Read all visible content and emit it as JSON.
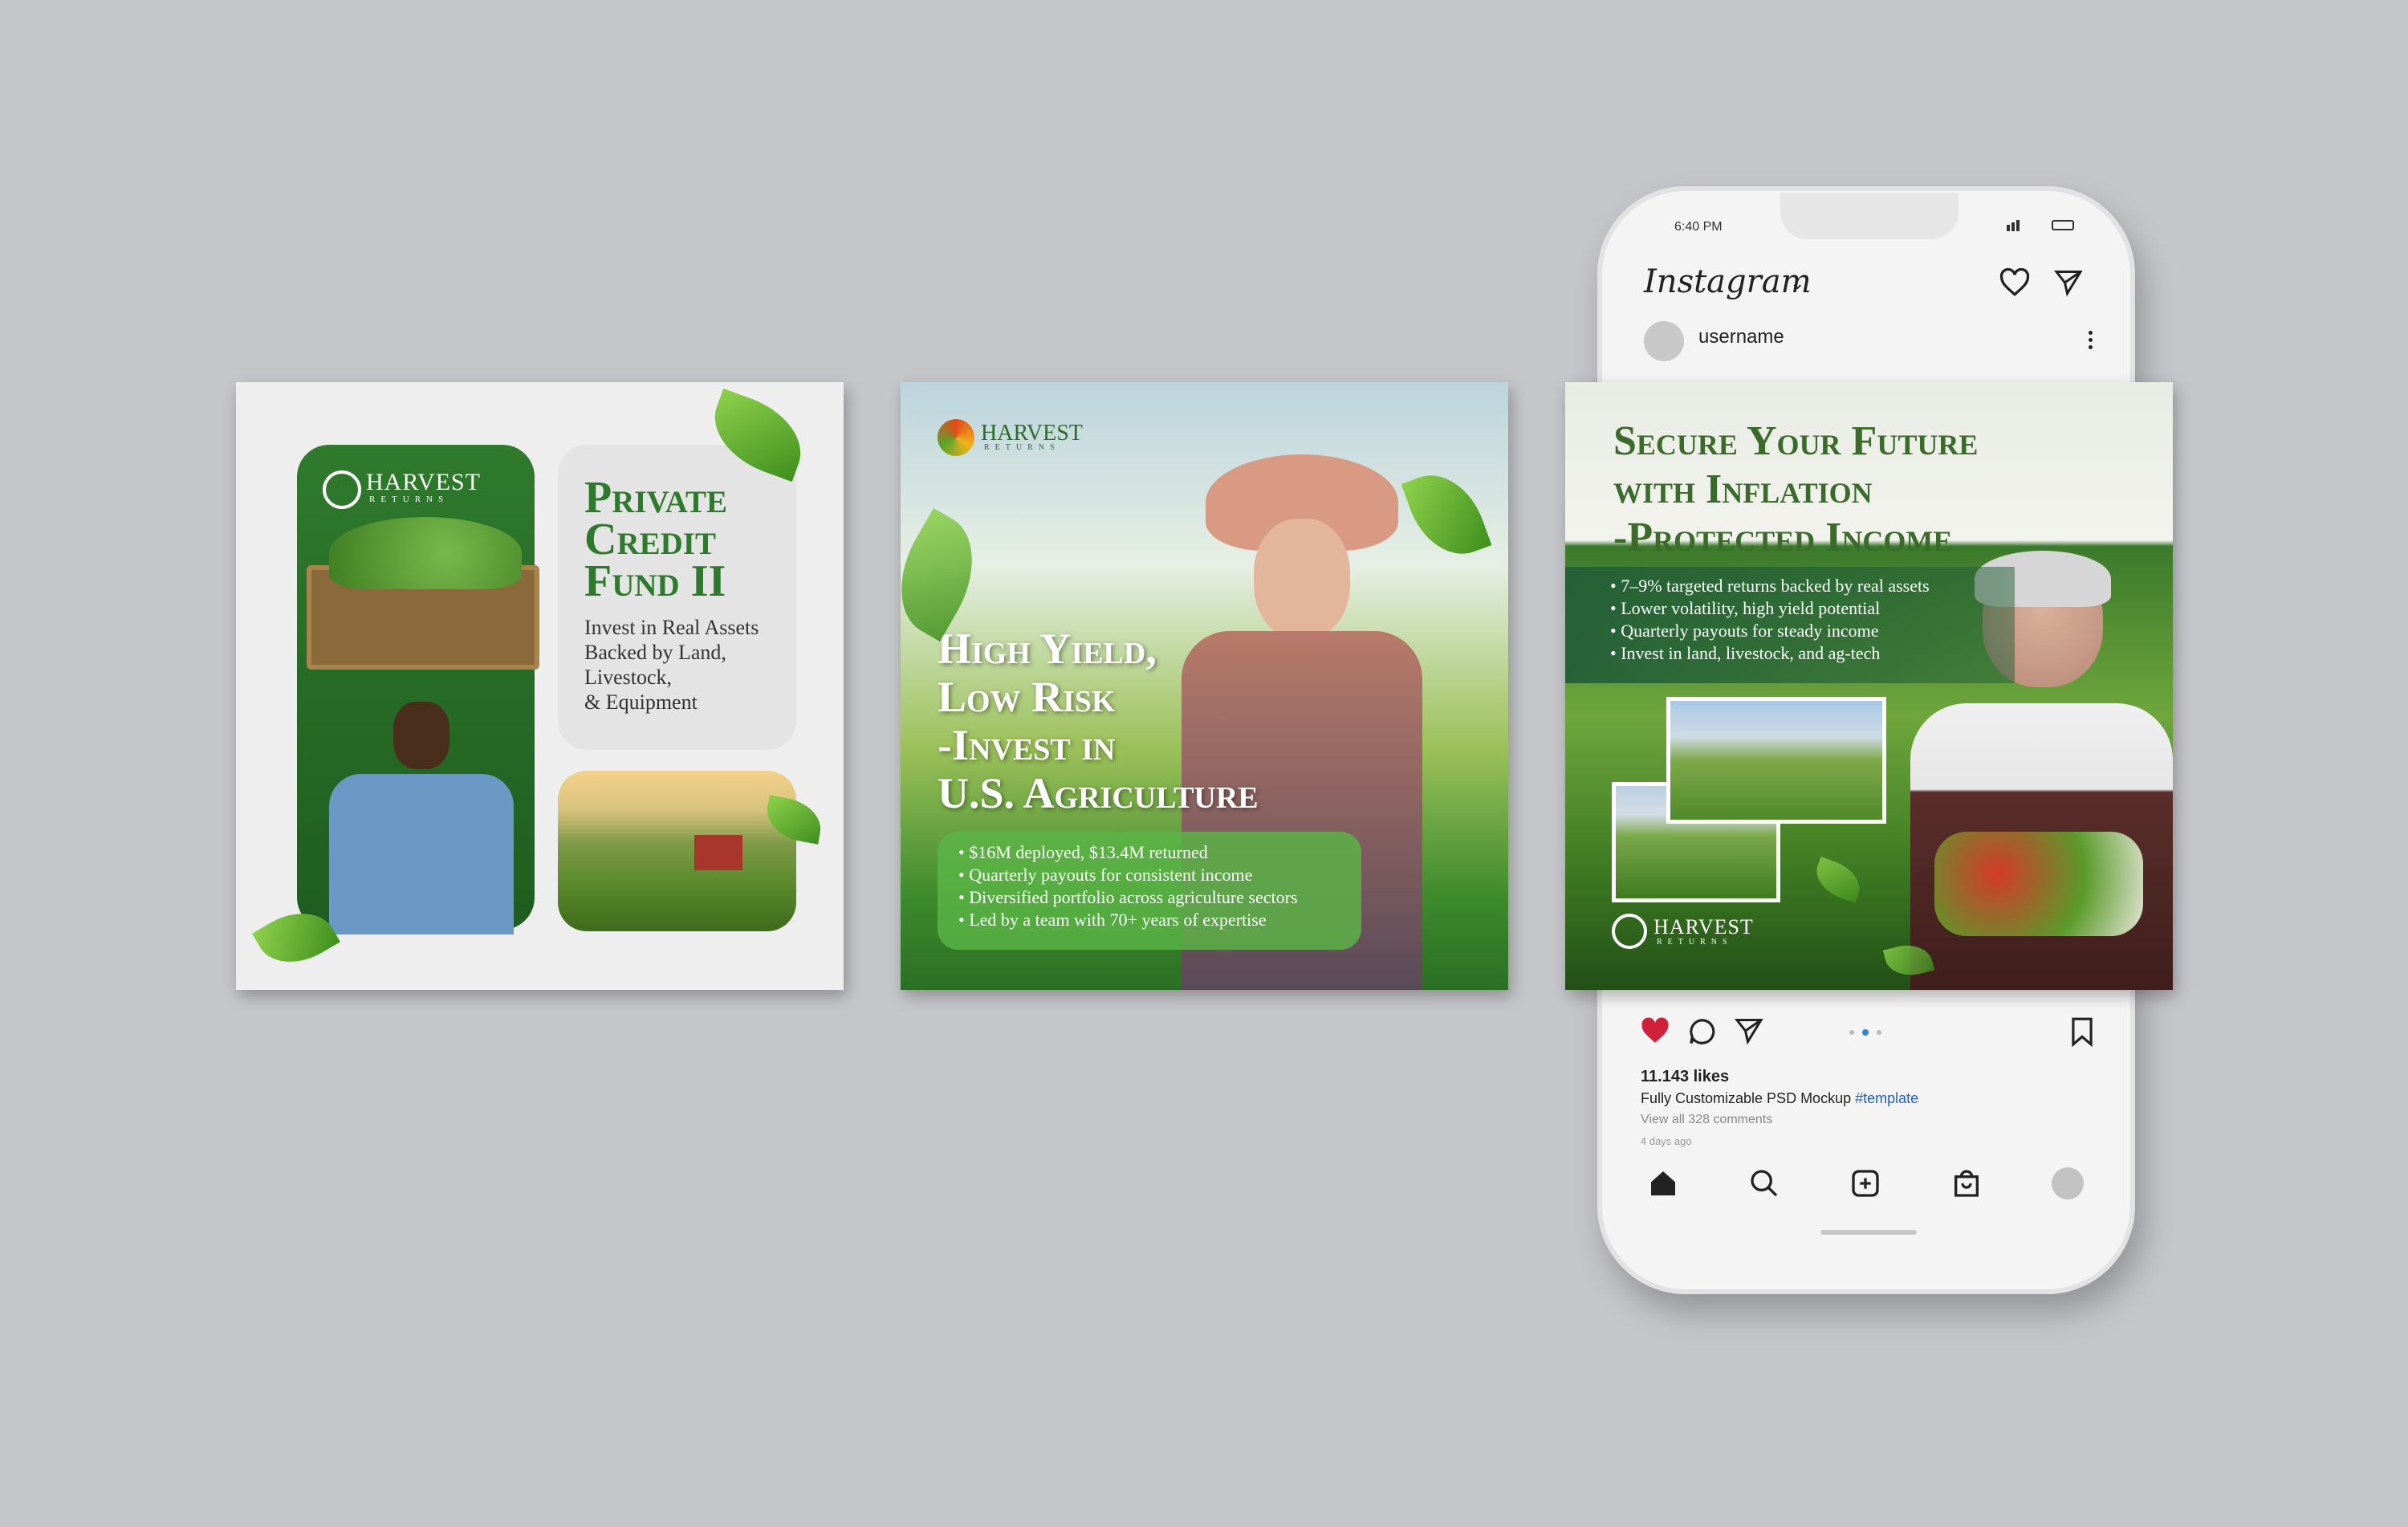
{
  "card1": {
    "logo": {
      "name": "HARVEST",
      "tagline": "RETURNS"
    },
    "title_lines": [
      "Private",
      "Credit",
      "Fund II"
    ],
    "subtitle_lines": [
      "Invest in Real Assets",
      "Backed by Land,",
      "Livestock,",
      "& Equipment"
    ]
  },
  "card2": {
    "logo": {
      "name": "HARVEST",
      "tagline": "RETURNS"
    },
    "title_lines": [
      "High Yield,",
      "Low Risk",
      "-Invest in",
      "U.S. Agriculture"
    ],
    "bullets": [
      "$16M deployed, $13.4M returned",
      "Quarterly payouts for consistent income",
      "Diversified portfolio across agriculture sectors",
      "Led by a team with 70+ years of expertise"
    ]
  },
  "card3": {
    "title_lines": [
      "Secure Your Future",
      "with Inflation",
      "-Protected Income"
    ],
    "bullets": [
      "7–9% targeted returns backed by real assets",
      "Lower volatility, high yield potential",
      "Quarterly payouts for steady income",
      "Invest in land, livestock, and ag-tech"
    ],
    "logo": {
      "name": "HARVEST",
      "tagline": "RETURNS"
    }
  },
  "phone": {
    "status_time": "6:40 PM",
    "app_name": "Instagram",
    "username": "username",
    "likes": "11.143 likes",
    "caption": "Fully Customizable PSD Mockup",
    "hashtag": "#template",
    "comments": "View all 328 comments",
    "posted_ago": "4 days ago"
  },
  "colors": {
    "brand_green": "#2e7a2c",
    "background": "#c5c6ca",
    "like_red": "#d1203a",
    "hashtag_blue": "#1f5fbf"
  },
  "icons": [
    "heart-icon",
    "send-icon",
    "more-icon",
    "comment-icon",
    "bookmark-icon",
    "home-icon",
    "search-icon",
    "add-icon",
    "shop-icon"
  ]
}
